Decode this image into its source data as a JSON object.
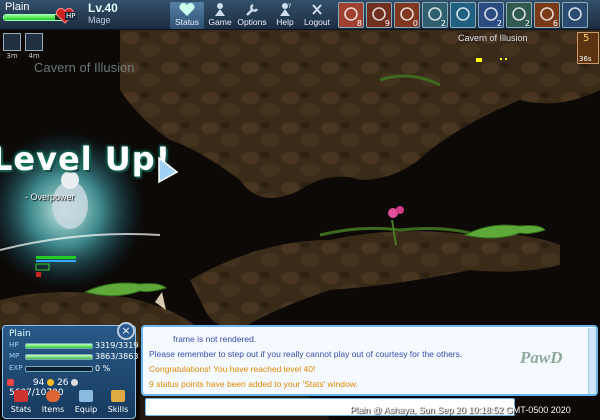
{
  "player": {
    "name": "Plain",
    "hp_tag": "HP",
    "level": "Lv.40",
    "class": "Mage",
    "hp_fill": 0.85
  },
  "menu": [
    {
      "label": "Status",
      "icon": "heart-icon",
      "active": true
    },
    {
      "label": "Game",
      "icon": "game-figure-icon",
      "active": false
    },
    {
      "label": "Options",
      "icon": "wrench-icon",
      "active": false
    },
    {
      "label": "Help",
      "icon": "help-figure-icon",
      "active": false
    },
    {
      "label": "Logout",
      "icon": "close-icon",
      "active": false
    }
  ],
  "skill_slots": [
    {
      "key": "8",
      "icon": "sword-skill-icon",
      "color": "#a04030"
    },
    {
      "key": "9",
      "icon": "fire-ring-skill-icon",
      "color": "#703020"
    },
    {
      "key": "0",
      "icon": "fire-burst-skill-icon",
      "color": "#803820"
    },
    {
      "key": "2",
      "icon": "gem-skill-icon",
      "color": "#306070"
    },
    {
      "key": "",
      "icon": "screen-skill-icon",
      "color": "#206080"
    },
    {
      "key": "2",
      "icon": "blue-orb-skill-icon",
      "color": "#2a4a80"
    },
    {
      "key": "2",
      "icon": "leaf-skill-icon",
      "color": "#305a50"
    },
    {
      "key": "6",
      "icon": "flame-skill-icon",
      "color": "#7a3a18"
    },
    {
      "key": "",
      "icon": "search-icon",
      "color": "#2a4a70"
    }
  ],
  "buffs": [
    {
      "icon": "shield-buff-icon",
      "time": "3m"
    },
    {
      "icon": "mage-buff-icon",
      "time": "4m"
    }
  ],
  "map": {
    "name": "Cavern of Illusion",
    "minimap_name": "Cavern of Illusion",
    "timer": "36s",
    "timer_top": "5"
  },
  "levelup_text": "Level Up!",
  "player_title": "- Overpower",
  "status_panel": {
    "name": "Plain",
    "hp_label": "HP",
    "hp_value": "3319/3319",
    "hp_fill": 1.0,
    "mp_label": "MP",
    "mp_value": "3863/3863",
    "mp_fill": 1.0,
    "exp_label": "EXP",
    "exp_value": "0 %",
    "exp_fill": 0.0,
    "gold": "94",
    "silver": "26",
    "weight": "5607/10700",
    "tabs": [
      "Stats",
      "Items",
      "Equip",
      "Skills"
    ],
    "close_label": "×"
  },
  "chat": [
    {
      "text": "frame is not rendered.",
      "color": "#3a4ab8"
    },
    {
      "text": "Please remember to step out if you really cannot play out of courtesy for the others.",
      "color": "#3a4ab8"
    },
    {
      "text": "Congratulations! You have reached level 40!",
      "color": "#e08a00"
    },
    {
      "text": "9 status points have been added to your 'Stats' window.",
      "color": "#e08a00"
    }
  ],
  "footer_stamp": "Plain @ Ashaya, Sun Sep 20 10:18:52 GMT-0500 2020",
  "watermark": "PawD"
}
